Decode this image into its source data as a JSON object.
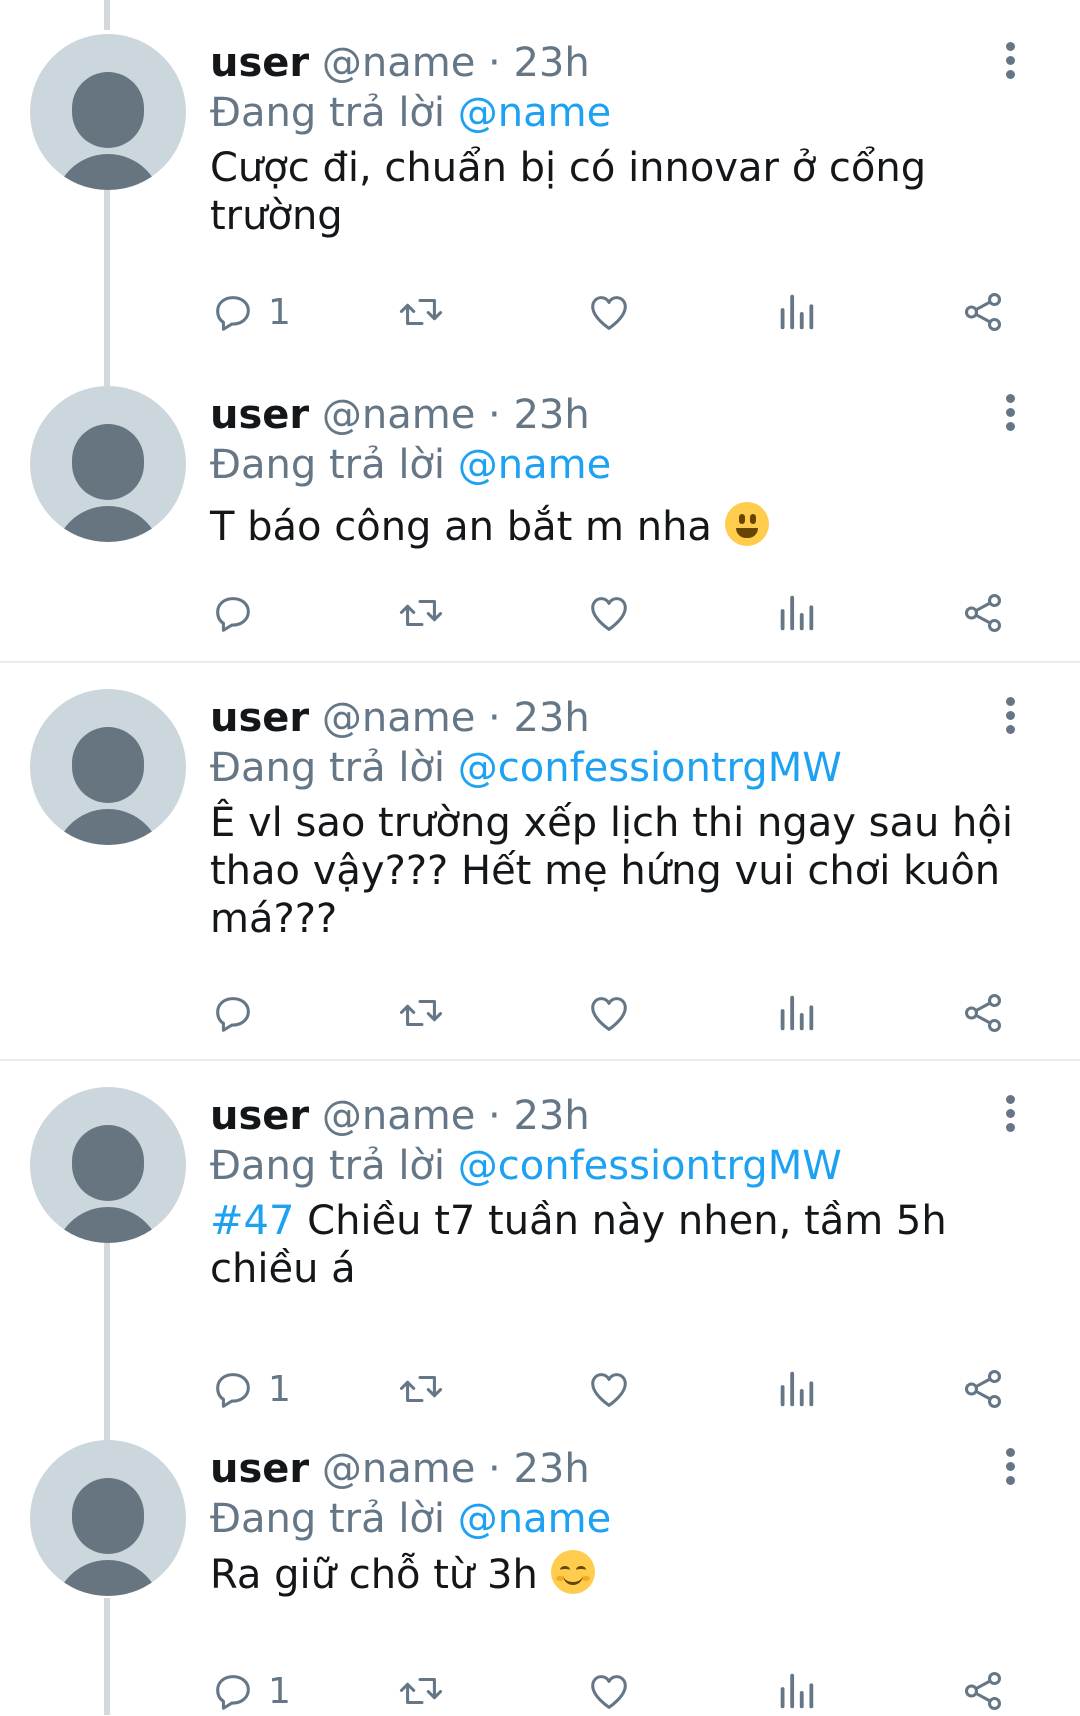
{
  "tweets": [
    {
      "user": "user",
      "handle": "@name",
      "dot": "·",
      "time": "23h",
      "replying_prefix": "Đang trả lời",
      "replying_to": "@name",
      "hashtag": "",
      "text": "Cược đi, chuẩn bị có innovar ở cổng trường",
      "emoji": "",
      "reply_count": "1"
    },
    {
      "user": "user",
      "handle": "@name",
      "dot": "·",
      "time": "23h",
      "replying_prefix": "Đang trả lời",
      "replying_to": "@name",
      "hashtag": "",
      "text": "T báo công an bắt m nha",
      "emoji": "grinning",
      "reply_count": ""
    },
    {
      "user": "user",
      "handle": "@name",
      "dot": "·",
      "time": "23h",
      "replying_prefix": "Đang trả lời",
      "replying_to": "@confessiontrgMW",
      "hashtag": "",
      "text": "Ê vl sao trường xếp lịch thi ngay sau hội thao vậy??? Hết mẹ hứng vui chơi kuôn má???",
      "emoji": "",
      "reply_count": ""
    },
    {
      "user": "user",
      "handle": "@name",
      "dot": "·",
      "time": "23h",
      "replying_prefix": "Đang trả lời",
      "replying_to": "@confessiontrgMW",
      "hashtag": "#47",
      "text": "Chiều t7 tuần này nhen, tầm 5h chiều á",
      "emoji": "",
      "reply_count": "1"
    },
    {
      "user": "user",
      "handle": "@name",
      "dot": "·",
      "time": "23h",
      "replying_prefix": "Đang trả lời",
      "replying_to": "@name",
      "hashtag": "",
      "text": "Ra giữ chỗ từ 3h",
      "emoji": "smiling",
      "reply_count": "1"
    }
  ],
  "icons": {
    "reply": "reply-icon",
    "retweet": "retweet-icon",
    "like": "like-icon",
    "analytics": "analytics-icon",
    "share": "share-icon",
    "more": "more-vertical-icon"
  },
  "colors": {
    "link": "#1da1f2",
    "secondary_text": "#657786",
    "primary_text": "#14171a",
    "avatar_bg": "#ccd6dd",
    "avatar_fg": "#66757f"
  }
}
